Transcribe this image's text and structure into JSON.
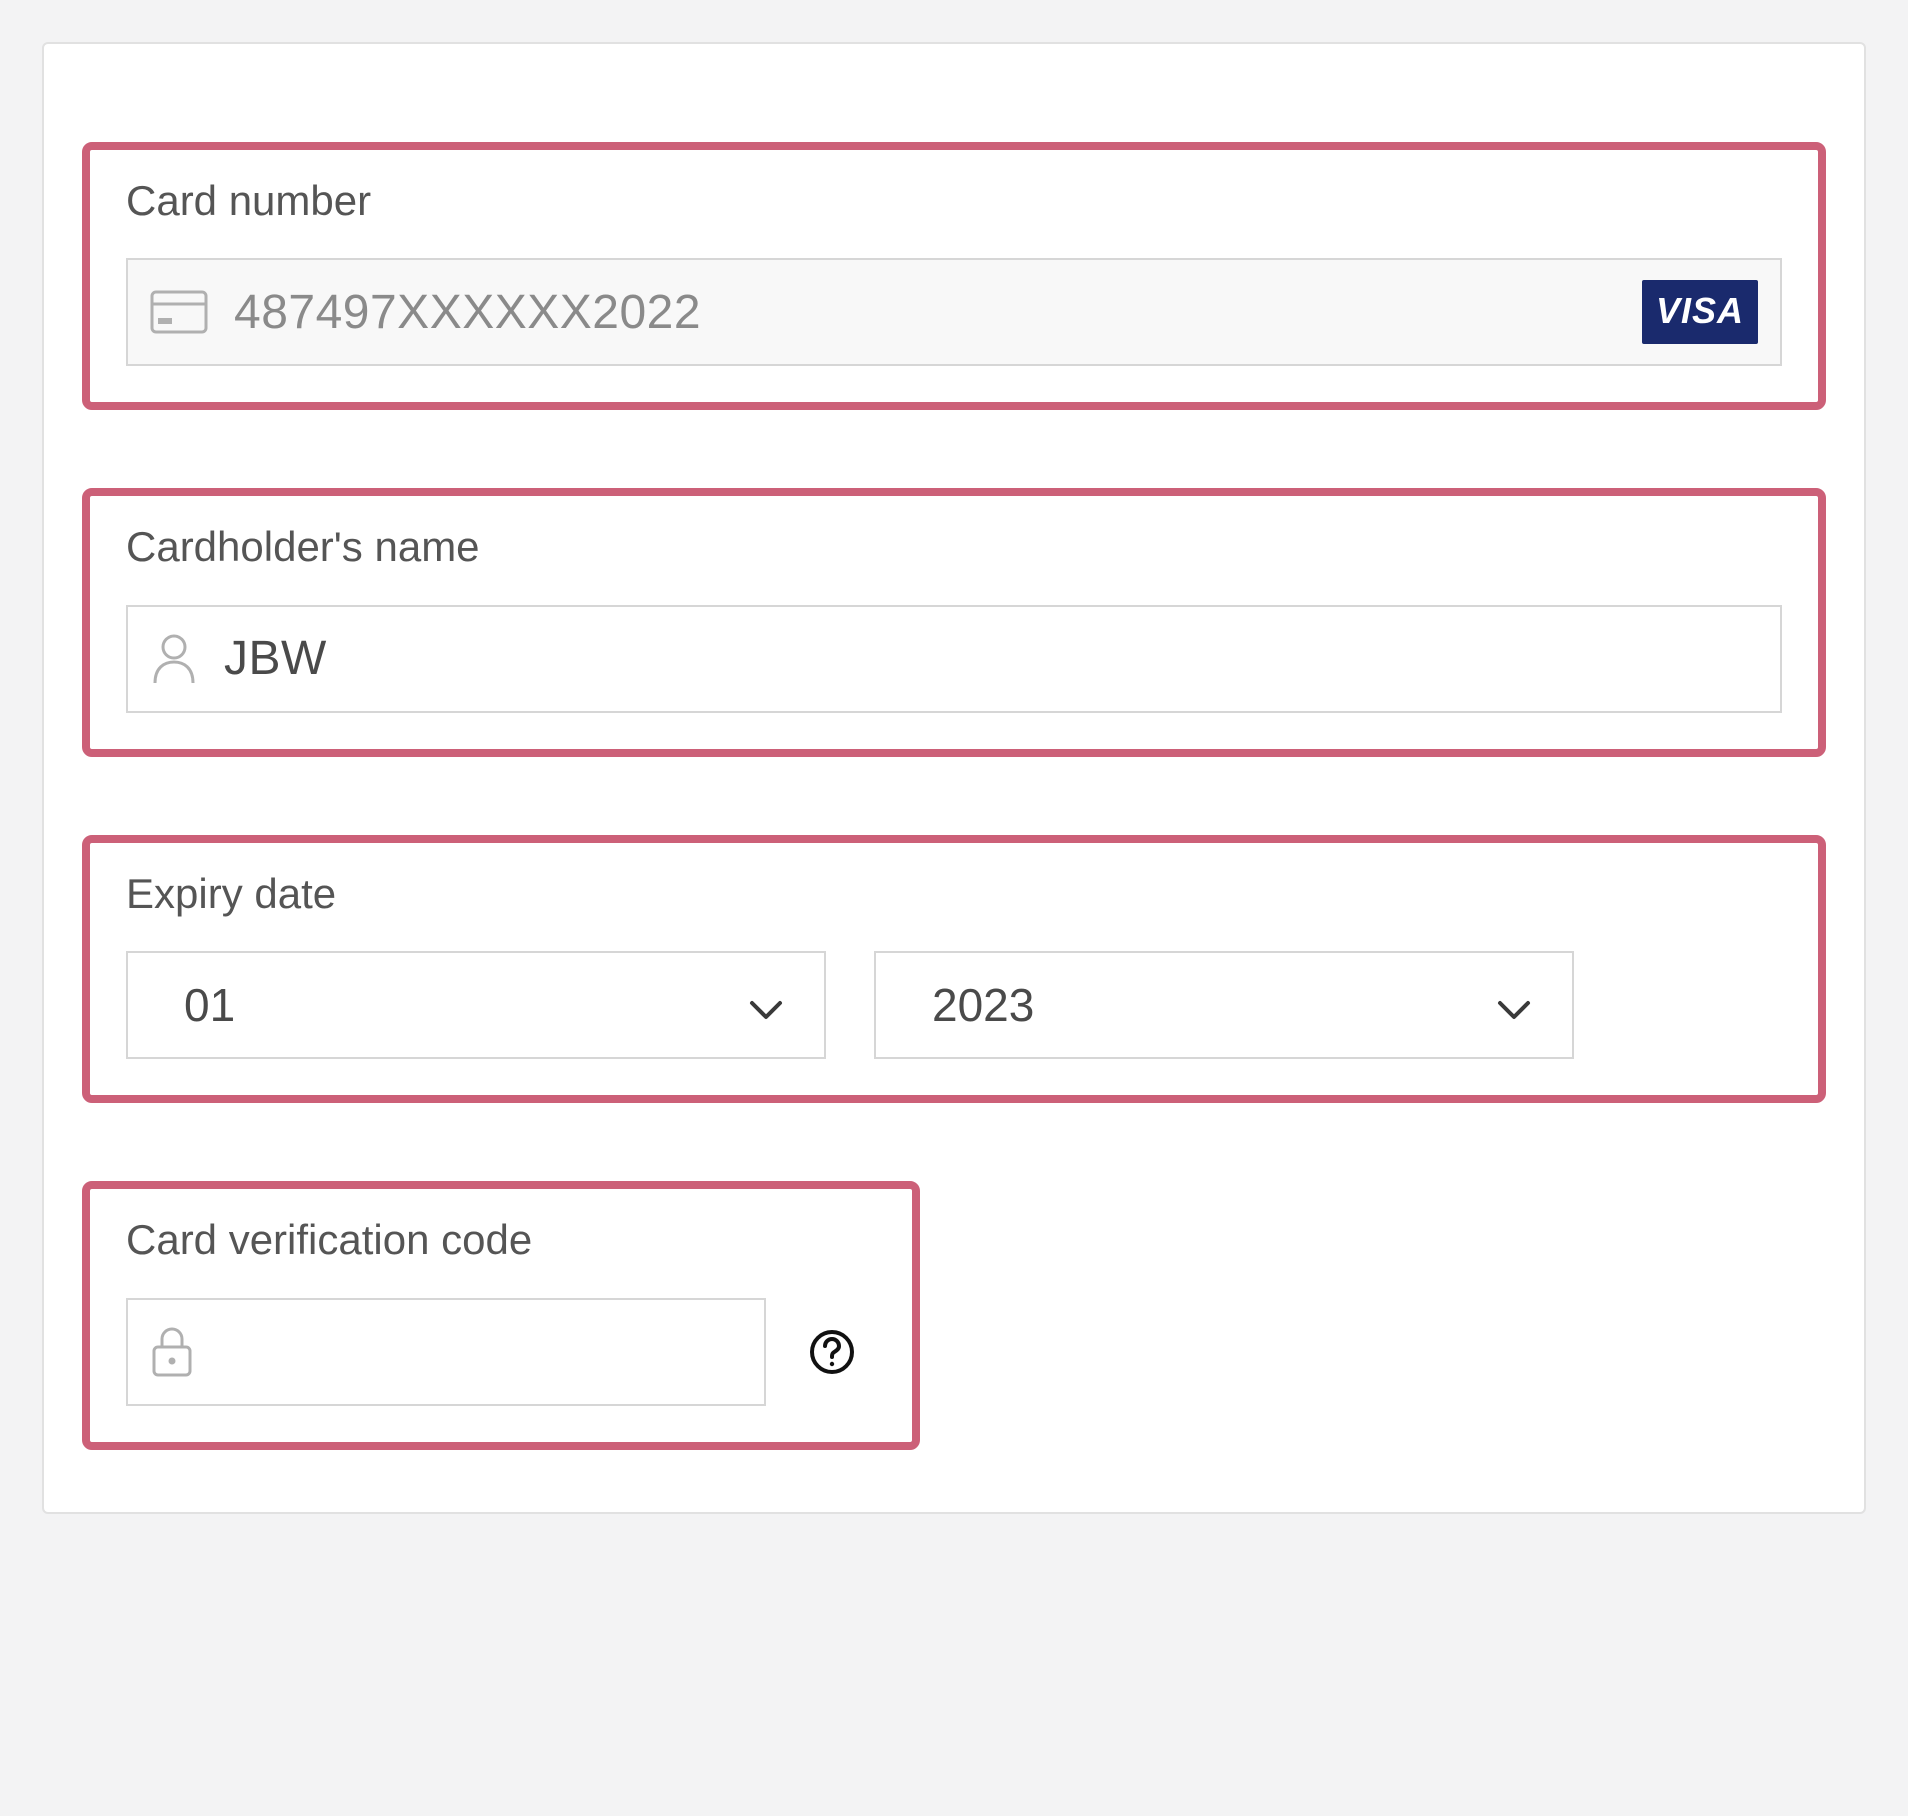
{
  "form": {
    "card_number": {
      "label": "Card number",
      "value": "487497XXXXXX2022",
      "brand": "VISA"
    },
    "cardholder": {
      "label": "Cardholder's name",
      "value": "JBW"
    },
    "expiry": {
      "label": "Expiry date",
      "month": "01",
      "year": "2023"
    },
    "cvc": {
      "label": "Card verification code",
      "value": ""
    }
  },
  "colors": {
    "highlight_border": "#cc6078",
    "visa_bg": "#1a2a6d"
  }
}
